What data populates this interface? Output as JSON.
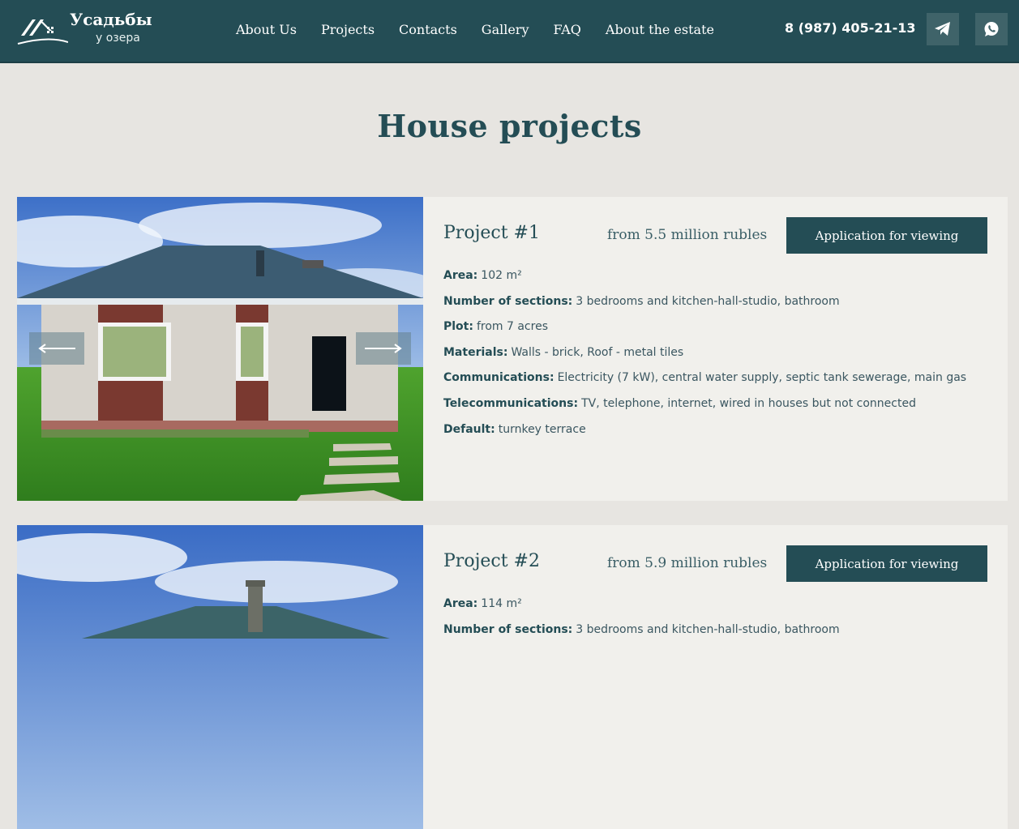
{
  "header": {
    "logo_title": "Усадьбы",
    "logo_subtitle": "у озера",
    "nav": [
      "About Us",
      "Projects",
      "Contacts",
      "Gallery",
      "FAQ",
      "About the estate"
    ],
    "phone": "8 (987) 405-21-13",
    "social": [
      "telegram-icon",
      "whatsapp-icon"
    ]
  },
  "page_title": "House projects",
  "projects": [
    {
      "title": "Project #1",
      "price": "from 5.5 million rubles",
      "button": "Application for viewing",
      "specs": [
        {
          "label": "Area:",
          "value": "102 m²"
        },
        {
          "label": "Number of sections:",
          "value": "3 bedrooms and kitchen-hall-studio, bathroom"
        },
        {
          "label": "Plot:",
          "value": "from 7 acres"
        },
        {
          "label": "Materials:",
          "value": "Walls - brick, Roof - metal tiles"
        },
        {
          "label": "Communications:",
          "value": "Electricity (7 kW), central water supply, septic tank sewerage, main gas"
        },
        {
          "label": "Telecommunications:",
          "value": "TV, telephone, internet, wired in houses but not connected"
        },
        {
          "label": "Default:",
          "value": "turnkey terrace"
        }
      ]
    },
    {
      "title": "Project #2",
      "price": "from 5.9 million rubles",
      "button": "Application for viewing",
      "specs": [
        {
          "label": "Area:",
          "value": "114 m²"
        },
        {
          "label": "Number of sections:",
          "value": "3 bedrooms and kitchen-hall-studio, bathroom"
        }
      ]
    }
  ],
  "colors": {
    "header_bg": "#244d55",
    "page_bg": "#e7e5e1",
    "card_bg": "#f1f0ec",
    "accent": "#244d55"
  }
}
